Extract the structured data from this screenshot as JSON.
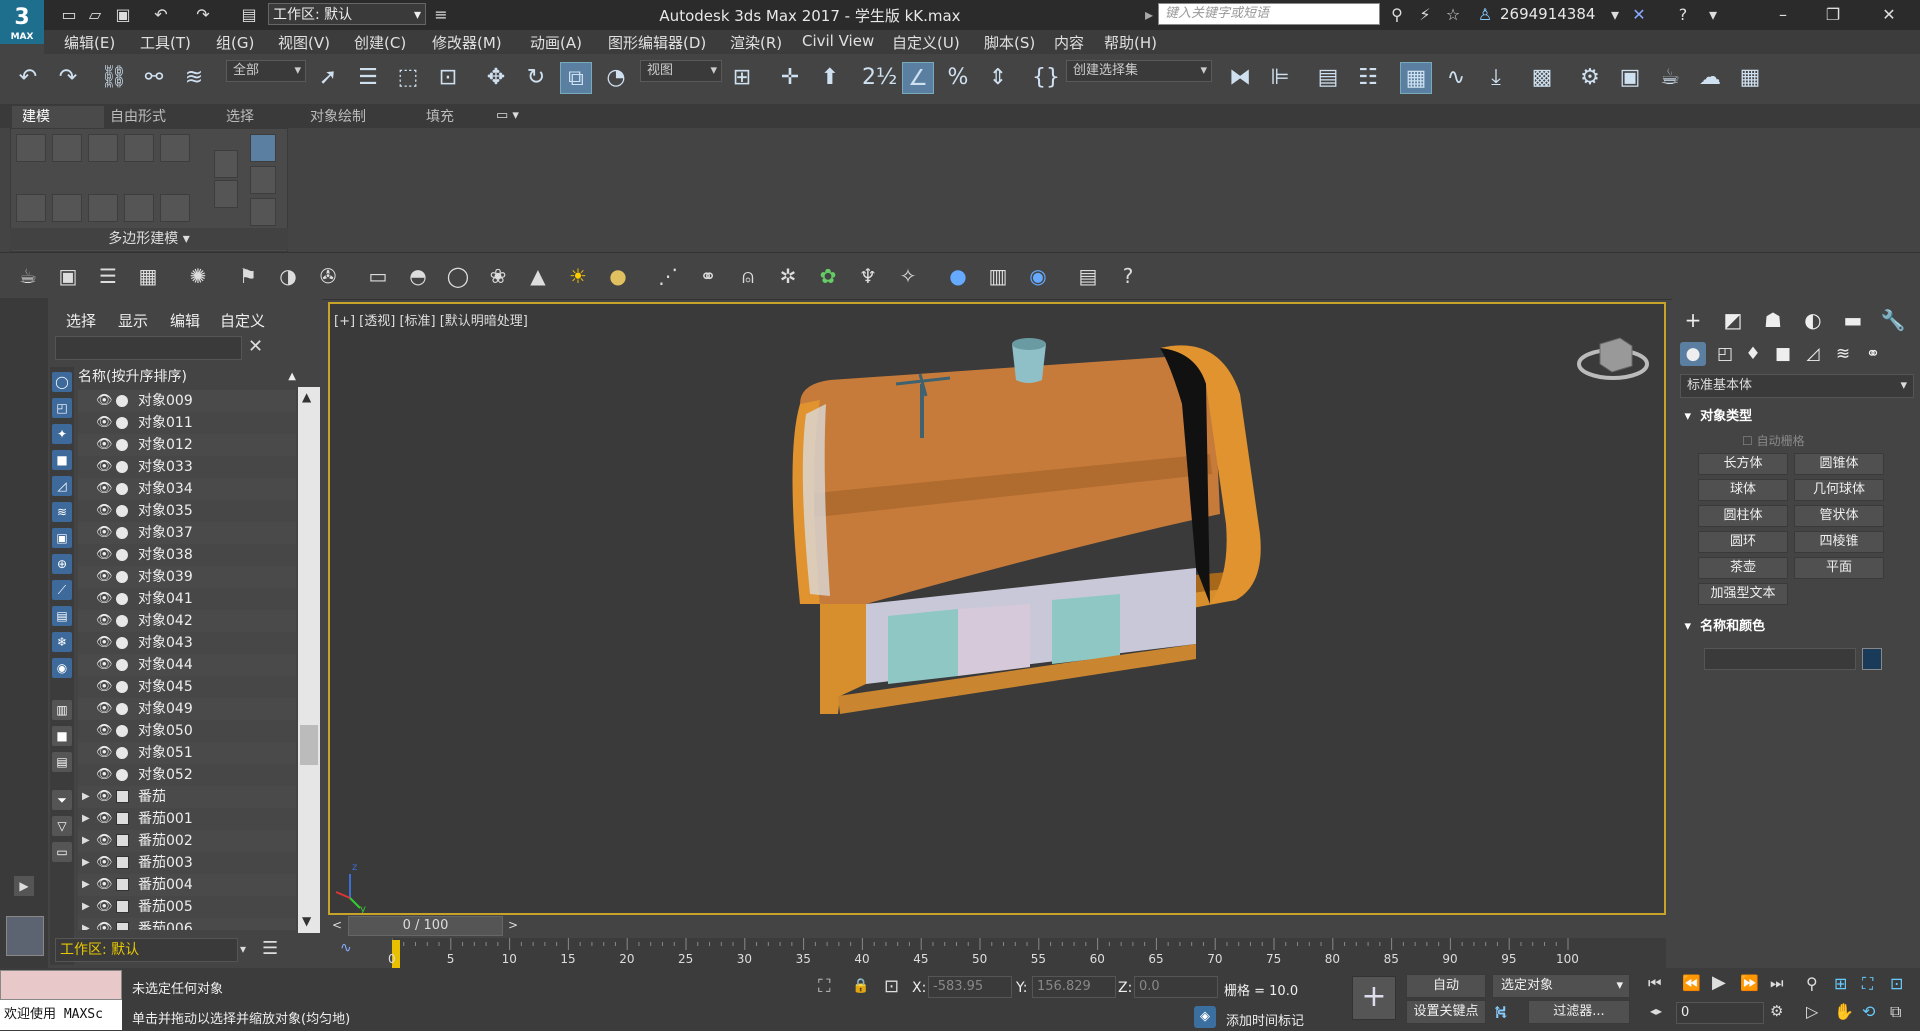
{
  "app": {
    "logo_text": "3",
    "logo_sub": "MAX",
    "title": "Autodesk 3ds Max 2017  - 学生版    kK.max",
    "workspace": "工作区: 默认",
    "search_placeholder": "键入关键字或短语",
    "user_id": "2694914384"
  },
  "menu": [
    "编辑(E)",
    "工具(T)",
    "组(G)",
    "视图(V)",
    "创建(C)",
    "修改器(M)",
    "动画(A)",
    "图形编辑器(D)",
    "渲染(R)",
    "Civil View",
    "自定义(U)",
    "脚本(S)",
    "内容",
    "帮助(H)"
  ],
  "toolbar": {
    "selection_filter": "全部",
    "ref_coord": "视图",
    "named_selection": "创建选择集"
  },
  "ribbon": {
    "tabs": [
      "建模",
      "自由形式",
      "选择",
      "对象绘制",
      "填充"
    ],
    "active_tab": "建模",
    "panel_label": "多边形建模 ▾"
  },
  "explorer": {
    "menu": [
      "选择",
      "显示",
      "编辑",
      "自定义"
    ],
    "column_header": "名称(按升序排序)",
    "objects": [
      "对象009",
      "对象011",
      "对象012",
      "对象033",
      "对象034",
      "对象035",
      "对象037",
      "对象038",
      "对象039",
      "对象041",
      "对象042",
      "对象043",
      "对象044",
      "对象045",
      "对象049",
      "对象050",
      "对象051",
      "对象052"
    ],
    "groups": [
      "番茄",
      "番茄001",
      "番茄002",
      "番茄003",
      "番茄004",
      "番茄005",
      "番茄006"
    ],
    "footer_workspace": "工作区: 默认"
  },
  "viewport": {
    "label": "[+] [透视] [标准] [默认明暗处理]",
    "border_color": "#c7a32a"
  },
  "command_panel": {
    "category": "标准基本体",
    "section_object_type": "对象类型",
    "autogrid": "自动栅格",
    "primitives": [
      "长方体",
      "圆锥体",
      "球体",
      "几何球体",
      "圆柱体",
      "管状体",
      "圆环",
      "四棱锥",
      "茶壶",
      "平面",
      "加强型文本"
    ],
    "section_name_color": "名称和颜色",
    "object_color": "#1a3a5a"
  },
  "timeline": {
    "slider_text": "0 / 100",
    "ticks": [
      "0",
      "5",
      "10",
      "15",
      "20",
      "25",
      "30",
      "35",
      "40",
      "45",
      "50",
      "55",
      "60",
      "65",
      "70",
      "75",
      "80",
      "85",
      "90",
      "95",
      "100"
    ]
  },
  "status": {
    "selection_info": "未选定任何对象",
    "prompt": "单击并拖动以选择并缩放对象(均匀地)",
    "maxscript_prompt": "欢迎使用 MAXSc",
    "x_label": "X:",
    "x_value": "-583.95",
    "y_label": "Y:",
    "y_value": "156.829",
    "z_label": "Z:",
    "z_value": "0.0",
    "grid": "栅格 = 10.0",
    "add_time_tag": "添加时间标记",
    "auto_key": "自动",
    "set_key": "设置关键点",
    "key_filter_select": "选定对象",
    "filters": "过滤器...",
    "frame": "0"
  }
}
